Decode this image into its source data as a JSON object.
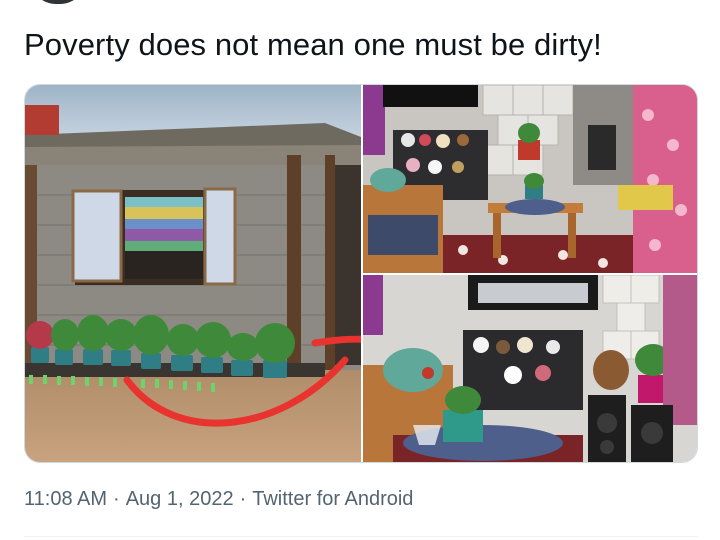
{
  "tweet": {
    "text": "Poverty does not mean one must be dirty!",
    "time": "11:08 AM",
    "date": "Aug 1, 2022",
    "source": "Twitter for Android",
    "separator": "·"
  },
  "colors": {
    "text_primary": "#0f1419",
    "text_secondary": "#536471",
    "border": "#cfd9de",
    "annotation_red": "#e8332e"
  }
}
